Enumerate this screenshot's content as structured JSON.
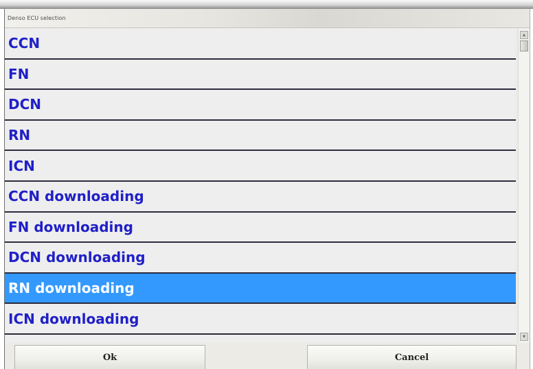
{
  "window": {
    "title": "Denso ECU selection"
  },
  "list": {
    "items": [
      {
        "label": "CCN"
      },
      {
        "label": "FN"
      },
      {
        "label": "DCN"
      },
      {
        "label": "RN"
      },
      {
        "label": "ICN"
      },
      {
        "label": "CCN downloading"
      },
      {
        "label": "FN downloading"
      },
      {
        "label": "DCN downloading"
      },
      {
        "label": "RN downloading",
        "selected": true
      },
      {
        "label": "ICN downloading"
      }
    ],
    "selected_index": 8
  },
  "buttons": {
    "ok_label": "Ok",
    "cancel_label": "Cancel"
  },
  "colors": {
    "item_text": "#2020c8",
    "selection_bg": "#3399ff",
    "selection_text": "#ffffff"
  },
  "icons": {
    "scroll_up": "scroll-up-arrow-icon",
    "scroll_down": "scroll-down-arrow-icon"
  }
}
